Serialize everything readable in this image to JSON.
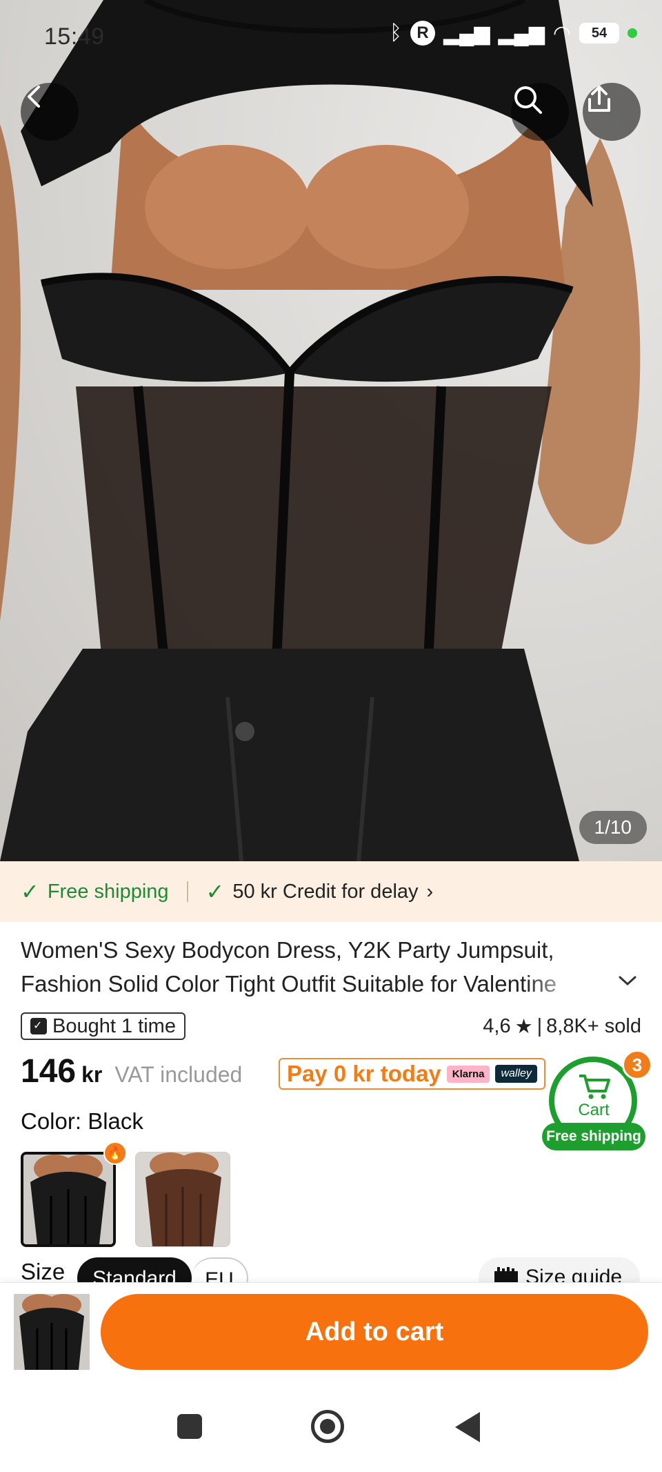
{
  "status_bar": {
    "time": "15:49",
    "battery": "54"
  },
  "gallery": {
    "page_indicator": "1/10"
  },
  "shipping_strip": {
    "free_shipping": "Free shipping",
    "credit": "50 kr Credit for delay"
  },
  "product": {
    "title": "Women'S Sexy Bodycon Dress, Y2K Party Jumpsuit, Fashion Solid Color Tight Outfit Suitable for Valentine",
    "bought_badge": "Bought 1 time",
    "rating": "4,6",
    "sold": "8,8K+ sold",
    "price": "146",
    "currency": "kr",
    "vat": "VAT included",
    "pay_later": "Pay 0 kr today",
    "klarna": "Klarna",
    "walley": "walley",
    "color_label": "Color: Black",
    "size_label": "Size",
    "size_tabs": [
      "Standard",
      "EU"
    ],
    "size_guide": "Size guide"
  },
  "cart_widget": {
    "label": "Cart",
    "count": "3",
    "shipping": "Free shipping"
  },
  "bottom_bar": {
    "add_to_cart": "Add to cart"
  },
  "colors": {
    "accent_orange": "#f7720f",
    "shipping_green": "#1f8a34",
    "strip_bg": "#fdf0e3"
  }
}
